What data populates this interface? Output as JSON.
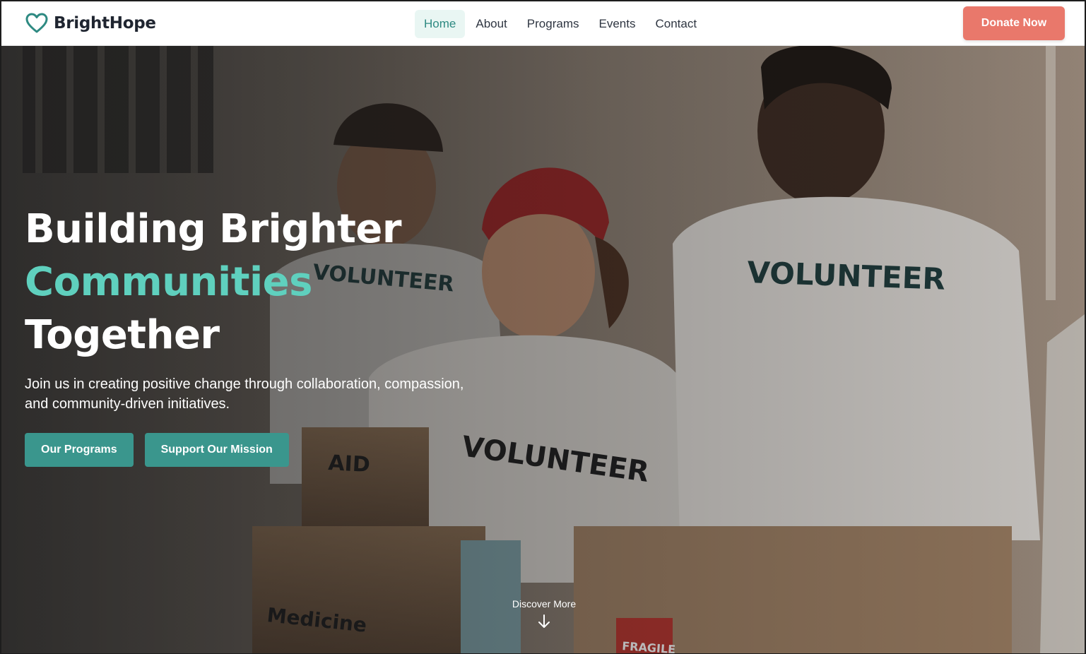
{
  "brand": {
    "name": "BrightHope",
    "icon": "heart-outline-icon",
    "accent_color": "#2e8a82"
  },
  "nav": {
    "items": [
      {
        "label": "Home",
        "active": true
      },
      {
        "label": "About",
        "active": false
      },
      {
        "label": "Programs",
        "active": false
      },
      {
        "label": "Events",
        "active": false
      },
      {
        "label": "Contact",
        "active": false
      }
    ]
  },
  "header": {
    "donate_label": "Donate Now",
    "donate_color": "#e9786b"
  },
  "hero": {
    "title_line1": "Building Brighter",
    "title_line2": "Communities",
    "title_line3": "Together",
    "title_accent_color": "#5fd0be",
    "subtitle": "Join us in creating positive change through collaboration, compassion, and community-driven initiatives.",
    "primary_button": "Our Programs",
    "secondary_button": "Support Our Mission",
    "button_color": "#3a968d",
    "discover_label": "Discover More",
    "discover_icon": "arrow-down-icon",
    "image_text": {
      "shirt_left": "VOLUNTEER",
      "shirt_center": "VOLUNTEER",
      "shirt_right": "VOLUNTEER",
      "box_aid": "AID",
      "box_medicine": "Medicine",
      "label_fragile": "FRAGILE"
    }
  }
}
